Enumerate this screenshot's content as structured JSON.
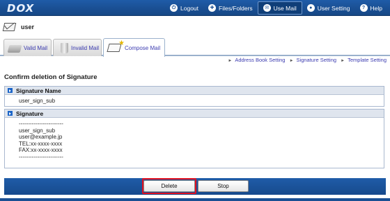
{
  "nav": {
    "logo": "DOX",
    "items": [
      {
        "label": "Logout",
        "icon": "logout-icon",
        "active": false
      },
      {
        "label": "Files/Folders",
        "icon": "files-icon",
        "active": false
      },
      {
        "label": "Use Mail",
        "icon": "mail-icon",
        "active": true
      },
      {
        "label": "User Setting",
        "icon": "user-icon",
        "active": false
      },
      {
        "label": "Help",
        "icon": "help-icon",
        "active": false
      }
    ]
  },
  "user": {
    "name": "user"
  },
  "tabs": [
    {
      "label": "Valid Mail",
      "icon": "valid-mail-icon"
    },
    {
      "label": "Invalid Mail",
      "icon": "trash-icon"
    },
    {
      "label": "Compose Mail",
      "icon": "compose-icon",
      "active": true
    }
  ],
  "links": [
    "Address Book Setting",
    "Signature Setting",
    "Template Setting"
  ],
  "page": {
    "title": "Confirm deletion of Signature"
  },
  "signature_name": {
    "header": "Signature Name",
    "value": "user_sign_sub"
  },
  "signature": {
    "header": "Signature",
    "lines": [
      "------------------------",
      "user_sign_sub",
      "user@example.jp",
      "TEL:xx-xxxx-xxxx",
      "FAX:xx-xxxx-xxxx",
      "------------------------"
    ]
  },
  "buttons": {
    "delete": "Delete",
    "stop": "Stop"
  },
  "colors": {
    "nav_bg": "#1a4f93",
    "highlight": "#e01020",
    "link": "#3b3bb0"
  }
}
